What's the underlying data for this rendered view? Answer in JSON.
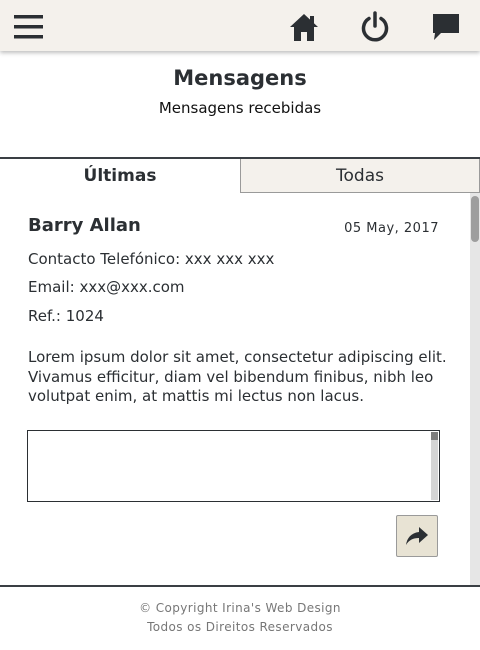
{
  "header": {
    "icons": {
      "menu": "menu-icon",
      "home": "home-icon",
      "power": "power-icon",
      "chat": "chat-icon"
    },
    "background_color": "#f4f1ec"
  },
  "page": {
    "title": "Mensagens",
    "subtitle": "Mensagens recebidas"
  },
  "tabs": [
    {
      "label": "Últimas",
      "active": true
    },
    {
      "label": "Todas",
      "active": false
    }
  ],
  "message": {
    "sender": "Barry Allan",
    "date": "05 May, 2017",
    "phone": "Contacto Telefónico: xxx xxx xxx",
    "email": "Email: xxx@xxx.com",
    "ref": "Ref.: 1024",
    "body": "Lorem ipsum dolor sit amet, consectetur adipiscing elit. Vivamus efficitur, diam vel bibendum finibus, nibh leo volutpat enim, at mattis mi lectus non lacus.",
    "reply_value": "",
    "send_icon": "share-arrow-icon"
  },
  "footer": {
    "line1": "© Copyright Irina's Web Design",
    "line2": "Todos os Direitos Reservados"
  },
  "colors": {
    "text": "#2b2f33",
    "tab_inactive_bg": "#f4f1ec",
    "send_button_bg": "#e8e3d4"
  }
}
